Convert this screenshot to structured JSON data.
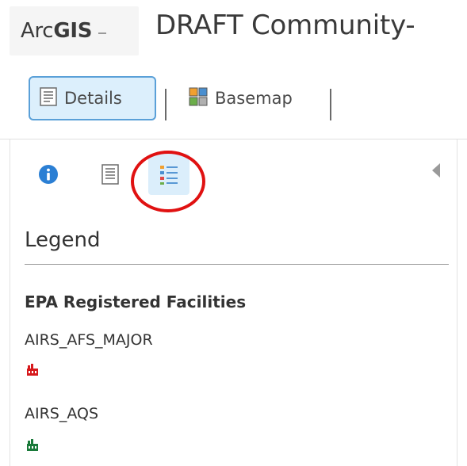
{
  "header": {
    "app_name_light": "Arc",
    "app_name_bold": "GIS",
    "title": "DRAFT Community-"
  },
  "toolbar": {
    "details_label": "Details",
    "basemap_label": "Basemap"
  },
  "panel": {
    "tabs": [
      "info-icon",
      "content-list-icon",
      "legend-list-icon"
    ],
    "active_tab": "legend",
    "heading": "Legend",
    "layer_title": "EPA Registered Facilities",
    "legend_items": [
      {
        "label": "AIRS_AFS_MAJOR",
        "symbol": "factory-icon",
        "color": "#d7191c"
      },
      {
        "label": "AIRS_AQS",
        "symbol": "factory-icon",
        "color": "#1a7a3a"
      }
    ]
  },
  "colors": {
    "accent_blue": "#5aa0d8",
    "active_bg": "#dceffc",
    "annotation_red": "#e01111"
  }
}
